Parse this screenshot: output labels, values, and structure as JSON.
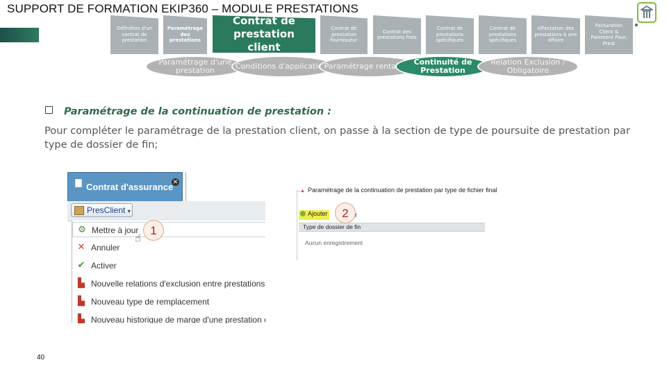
{
  "header": {
    "title": "SUPPORT DE FORMATION EKIP360 – MODULE PRESTATIONS"
  },
  "steps": [
    {
      "label": "Définition d'un contrat de prestation"
    },
    {
      "label": "Paramétrage des prestations"
    },
    {
      "label": "Contrat de prestation client"
    },
    {
      "label": "Contrat de prestation fournisseur"
    },
    {
      "label": "Contrat des prestations frais"
    },
    {
      "label": "Contrat de prestations spécifiques"
    },
    {
      "label": "Contrat de prestations spécifiques"
    },
    {
      "label": "Affectation des prestations à une affaire"
    },
    {
      "label": "Facturation Client & Paiement Four. Prest"
    }
  ],
  "substeps": [
    {
      "label": "Paramétrage d'une prestation"
    },
    {
      "label": "Conditions d'applications"
    },
    {
      "label": "Paramétrage rentabilité"
    },
    {
      "label": "Continuité de Prestation"
    },
    {
      "label": "Relation Exclusion / Obligatoire"
    }
  ],
  "section": {
    "heading": "Paramétrage de la continuation de prestation :",
    "body": "Pour compléter le paramétrage de la prestation client, on passe à la section de type de poursuite de prestation par type de dossier de fin;"
  },
  "screenshot_left": {
    "tab_label": "Contrat d'assurance",
    "dropdown_label": "PresClient",
    "menu_items": [
      {
        "label": "Mettre à jour",
        "icon": "gear-update-icon"
      },
      {
        "label": "Annuler",
        "icon": "cross-icon"
      },
      {
        "label": "Activer",
        "icon": "check-icon"
      },
      {
        "label": "Nouvelle relations d'exclusion entre prestations client",
        "icon": "add-doc-icon"
      },
      {
        "label": "Nouveau type de remplacement",
        "icon": "add-doc-icon"
      },
      {
        "label": "Nouveau historique de marge d'une prestation client",
        "icon": "add-doc-icon"
      }
    ],
    "badge": "1"
  },
  "screenshot_right": {
    "section_title": "Paramétrage de la continuation de prestation par type de fichier final",
    "add_label": "Ajouter",
    "second_label": "er",
    "column_header": "Type de dossier de fin",
    "empty_text": "Aucun enregistrement",
    "badge": "2"
  },
  "page_number": "40",
  "colors": {
    "accent_green": "#2c7a5d",
    "step_grey": "#a9b1b4",
    "heading_green": "#2d6b4a"
  }
}
